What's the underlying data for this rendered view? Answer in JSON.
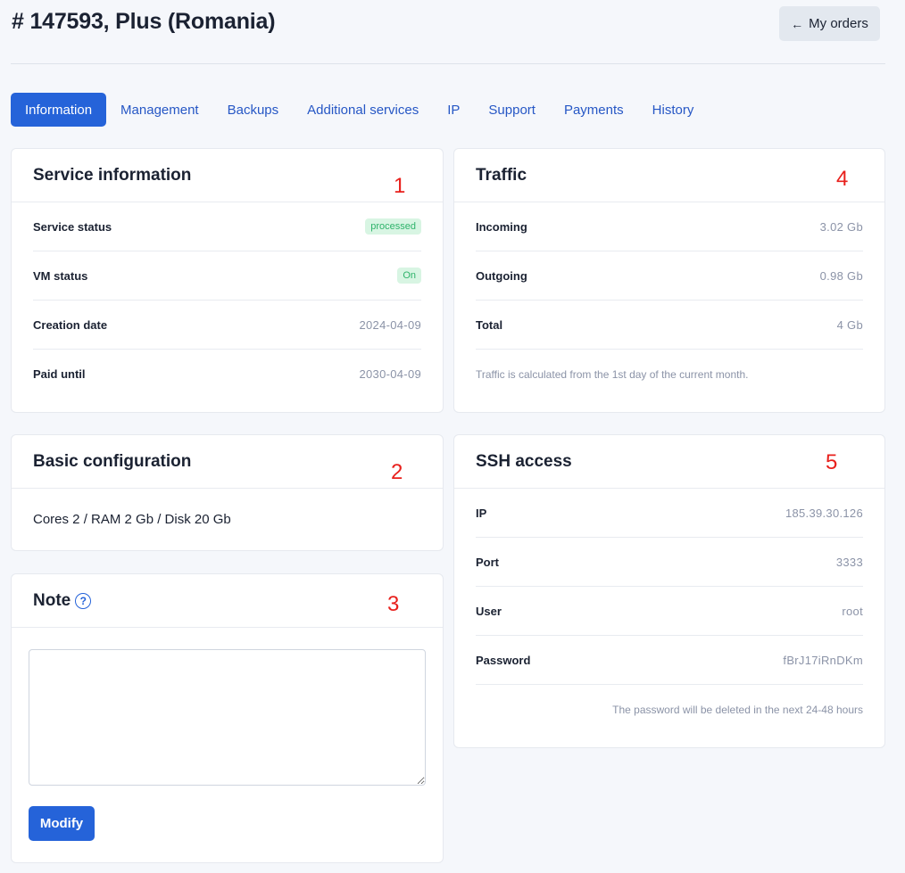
{
  "page": {
    "title": "# 147593, Plus (Romania)"
  },
  "back_button": {
    "arrow": "←",
    "label": "My orders"
  },
  "tabs": [
    "Information",
    "Management",
    "Backups",
    "Additional services",
    "IP",
    "Support",
    "Payments",
    "History"
  ],
  "service_info": {
    "title": "Service information",
    "marker": "1",
    "rows": [
      {
        "label": "Service status",
        "value": "processed"
      },
      {
        "label": "VM status",
        "value": "On"
      },
      {
        "label": "Creation date",
        "value": "2024-04-09"
      },
      {
        "label": "Paid until",
        "value": "2030-04-09"
      }
    ]
  },
  "basic_config": {
    "title": "Basic configuration",
    "marker": "2",
    "text": "Cores 2 / RAM 2 Gb / Disk 20 Gb"
  },
  "note": {
    "title": "Note",
    "help_glyph": "?",
    "marker": "3",
    "value": "",
    "button_label": "Modify"
  },
  "traffic": {
    "title": "Traffic",
    "marker": "4",
    "rows": [
      {
        "label": "Incoming",
        "value": "3.02 Gb"
      },
      {
        "label": "Outgoing",
        "value": "0.98 Gb"
      },
      {
        "label": "Total",
        "value": "4 Gb"
      }
    ],
    "footnote": "Traffic is calculated from the 1st day of the current month."
  },
  "ssh": {
    "title": "SSH access",
    "marker": "5",
    "rows": [
      {
        "label": "IP",
        "value": "185.39.30.126"
      },
      {
        "label": "Port",
        "value": "3333"
      },
      {
        "label": "User",
        "value": "root"
      },
      {
        "label": "Password",
        "value": "fBrJ17iRnDKm"
      }
    ],
    "footnote": "The password will be deleted in the next 24-48 hours"
  },
  "colors": {
    "accent": "#2563d9",
    "link": "#2657c5",
    "marker": "#e8201c",
    "badge_bg": "#d8f5e3",
    "badge_text": "#2fb36b"
  }
}
